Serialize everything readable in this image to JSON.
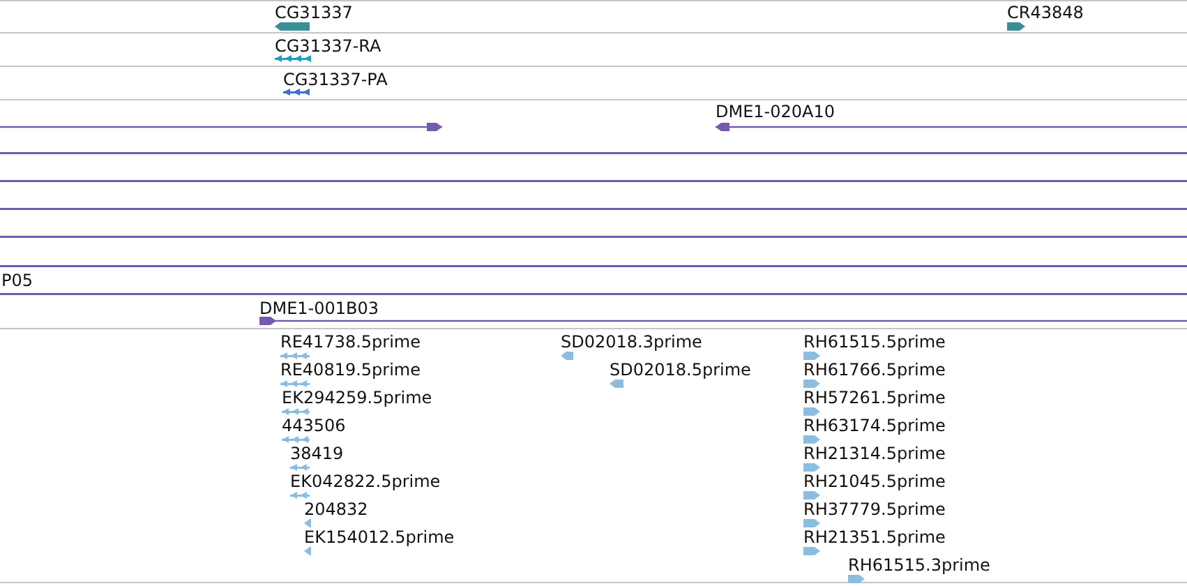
{
  "tracks": [
    {
      "features": [
        {
          "label": "CG31337",
          "kind": "block",
          "reverse": true,
          "color": "#3a8f96"
        },
        {
          "label": "CR43848",
          "kind": "block",
          "reverse": false,
          "color": "#3a8f96"
        }
      ]
    },
    {
      "features": [
        {
          "label": "CG31337-RA",
          "kind": "exons",
          "reverse": true,
          "color": "#1aa0c4"
        }
      ]
    },
    {
      "features": [
        {
          "label": "CG31337-PA",
          "kind": "exons",
          "reverse": true,
          "color": "#3b6fcf"
        }
      ]
    },
    {
      "features": [
        {
          "kind": "line",
          "reverse": false,
          "color": "#7459ae"
        },
        {
          "label": "DME1-020A10",
          "kind": "line",
          "reverse": true,
          "color": "#7459ae"
        },
        {
          "kind": "line",
          "color": "#7459ae"
        },
        {
          "kind": "line",
          "color": "#7459ae"
        },
        {
          "kind": "line",
          "color": "#7459ae"
        },
        {
          "kind": "line",
          "color": "#7459ae"
        },
        {
          "kind": "line",
          "color": "#7459ae"
        },
        {
          "label": "P05",
          "kind": "line",
          "color": "#7459ae"
        },
        {
          "label": "DME1-001B03",
          "kind": "line",
          "reverse": false,
          "color": "#7459ae"
        }
      ]
    },
    {
      "features": [
        {
          "label": "RE41738.5prime",
          "kind": "exons",
          "reverse": true,
          "color": "#8cbde0"
        },
        {
          "label": "RE40819.5prime",
          "kind": "exons",
          "reverse": true,
          "color": "#8cbde0"
        },
        {
          "label": "EK294259.5prime",
          "kind": "exons",
          "reverse": true,
          "color": "#8cbde0"
        },
        {
          "label": "443506",
          "kind": "exons",
          "reverse": true,
          "color": "#8cbde0"
        },
        {
          "label": "38419",
          "kind": "exons",
          "reverse": true,
          "color": "#8cbde0"
        },
        {
          "label": "EK042822.5prime",
          "kind": "exons",
          "reverse": true,
          "color": "#8cbde0"
        },
        {
          "label": "204832",
          "kind": "block",
          "reverse": true,
          "color": "#8cbde0"
        },
        {
          "label": "EK154012.5prime",
          "kind": "block",
          "reverse": true,
          "color": "#8cbde0"
        },
        {
          "label": "SD02018.3prime",
          "kind": "block",
          "reverse": true,
          "color": "#8cbde0"
        },
        {
          "label": "SD02018.5prime",
          "kind": "block",
          "reverse": true,
          "color": "#8cbde0"
        },
        {
          "label": "RH61515.5prime",
          "kind": "block",
          "reverse": false,
          "color": "#8cbde0"
        },
        {
          "label": "RH61766.5prime",
          "kind": "block",
          "reverse": false,
          "color": "#8cbde0"
        },
        {
          "label": "RH57261.5prime",
          "kind": "block",
          "reverse": false,
          "color": "#8cbde0"
        },
        {
          "label": "RH63174.5prime",
          "kind": "block",
          "reverse": false,
          "color": "#8cbde0"
        },
        {
          "label": "RH21314.5prime",
          "kind": "block",
          "reverse": false,
          "color": "#8cbde0"
        },
        {
          "label": "RH21045.5prime",
          "kind": "block",
          "reverse": false,
          "color": "#8cbde0"
        },
        {
          "label": "RH37779.5prime",
          "kind": "block",
          "reverse": false,
          "color": "#8cbde0"
        },
        {
          "label": "RH21351.5prime",
          "kind": "block",
          "reverse": false,
          "color": "#8cbde0"
        },
        {
          "label": "RH61515.3prime",
          "kind": "block",
          "reverse": false,
          "color": "#8cbde0"
        }
      ]
    }
  ]
}
